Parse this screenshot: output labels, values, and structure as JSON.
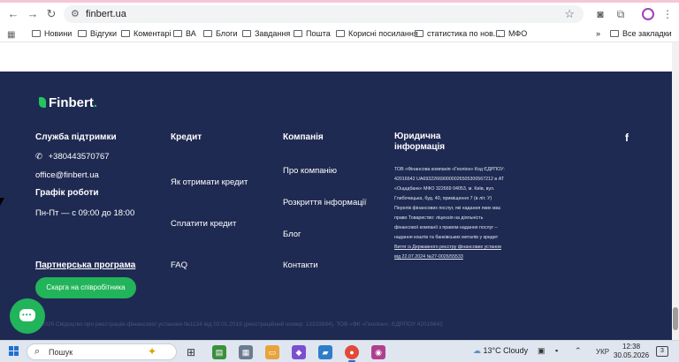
{
  "browser": {
    "url": "finbert.ua",
    "bookmarks": [
      "Новини",
      "Відгуки",
      "Коментарі",
      "ВА",
      "Блоги",
      "Завдання",
      "Пошта",
      "Корисні посилання",
      "статистика по нов...",
      "МФО"
    ],
    "all_bookmarks": "Все закладки",
    "more": "»"
  },
  "footer": {
    "logo_text": "Finbert",
    "logo_dot": ".",
    "support": {
      "title": "Служба підтримки",
      "phone": "+380443570767",
      "email": "office@finbert.ua",
      "schedule_title": "Графік роботи",
      "schedule": "Пн-Пт — с 09:00 до 18:00"
    },
    "credit": {
      "title": "Кредит",
      "links": [
        "Як отримати кредит",
        "Сплатити кредит",
        "FAQ"
      ]
    },
    "company": {
      "title": "Компанія",
      "links": [
        "Про компанію",
        "Розкриття інформації",
        "Блог",
        "Контакти"
      ]
    },
    "legal": {
      "title": "Юридична інформація",
      "text": "ТОВ «Фінансова компанія «Геоліон» Код ЄДРПОУ: 42016642 UA693226690000026505300567212 в АТ «Ощадбанк» МФО 322669 04053, м. Київ, вул. Глибочицька, буд. 40, приміщення 7 (в літ. У) Перелік фінансових послуг, які надання яких має право Товариство: ліцензія на діяльність фінансової компанії з правом надання послуг – надання коштів та банківських металів у кредит",
      "link": "Витяг із Державного реєстру фінансових установ від 22.07.2024 №27-0026/55533"
    },
    "partner": {
      "title": "Партнерська програма",
      "button": "Скарга на співробітника"
    },
    "bottom": "© 2026 Свідоцтво про реєстрацію фінансової установи №1134 від 03.01.2019 (реєстраційний номер: 13103894). ТОВ «ФК «Геоліон», ЄДРПОУ 42016642",
    "social": "f"
  },
  "taskbar": {
    "search_placeholder": "Пошук",
    "weather": "13°C  Cloudy",
    "lang": "УКР",
    "time": "12:38",
    "date": "30.05.2026",
    "notifications": "3"
  },
  "colors": {
    "footer_bg": "#1f2a52",
    "accent_green": "#22b45a"
  }
}
